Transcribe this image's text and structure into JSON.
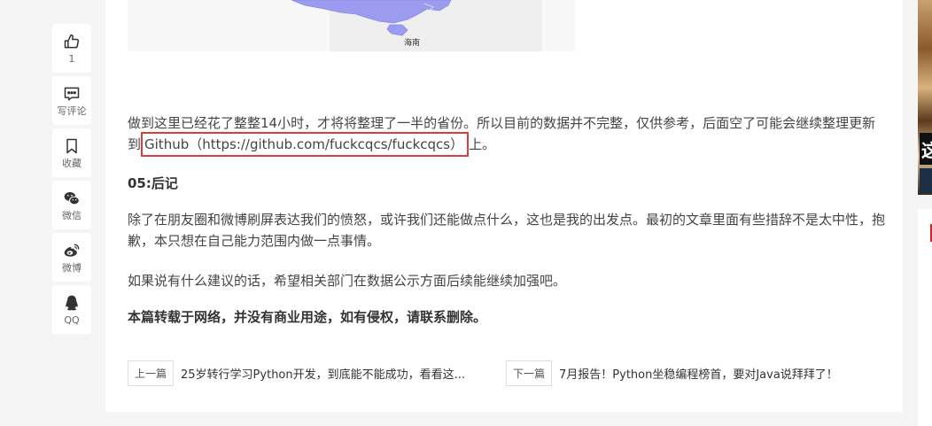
{
  "rail": {
    "like": {
      "icon": "thumbs-up-icon",
      "label": "1"
    },
    "comment": {
      "icon": "comment-icon",
      "label": "写评论"
    },
    "bookmark": {
      "icon": "bookmark-icon",
      "label": "收藏"
    },
    "wechat": {
      "icon": "wechat-icon",
      "label": "微信"
    },
    "weibo": {
      "icon": "weibo-icon",
      "label": "微博"
    },
    "qq": {
      "icon": "qq-icon",
      "label": "QQ"
    }
  },
  "map": {
    "label": "海南",
    "fill_color": "#9b9bf0"
  },
  "article": {
    "p1_before": "做到这里已经花了整整14小时，才将将整理了一半的省份。所以目前的数据并不完整，仅供参考，后面空了可能会继续整理更新到",
    "p1_link": "Github（https://github.com/fuckcqcs/fuckcqcs）",
    "p1_after": "上。",
    "heading": "05:后记",
    "p2": "除了在朋友圈和微博刷屏表达我们的愤怒，或许我们还能做点什么，这也是我的出发点。最初的文章里面有些措辞不是太中性，抱歉，本只想在自己能力范围内做一点事情。",
    "p3": "如果说有什么建议的话，希望相关部门在数据公示方面后续能继续加强吧。",
    "p4": "本篇转载于网络，并没有商业用途，如有侵权，请联系删除。",
    "highlight_color": "#e03b3b"
  },
  "nav": {
    "prev_tag": "上一篇",
    "prev_title": "25岁转行学习Python开发，到底能不能成功，看看这...",
    "next_tag": "下一篇",
    "next_title": "7月报告！Python坐稳编程榜首，要对Java说拜拜了！"
  },
  "ad": {
    "char": "这"
  }
}
